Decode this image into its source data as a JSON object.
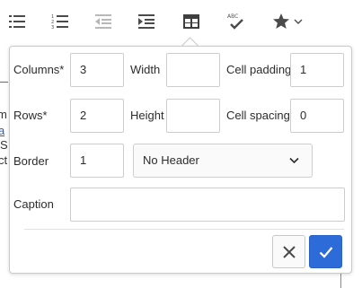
{
  "toolbar": {
    "items": [
      "bulleted-list",
      "numbered-list",
      "outdent",
      "indent",
      "table",
      "spellcheck",
      "more"
    ],
    "spellcheck_text": "ABC"
  },
  "background": {
    "fragments": [
      "m",
      "a",
      "S",
      "ct"
    ]
  },
  "table_dialog": {
    "columns_label": "Columns*",
    "columns_value": "3",
    "width_label": "Width",
    "width_value": "",
    "cell_padding_label": "Cell padding",
    "cell_padding_value": "1",
    "rows_label": "Rows*",
    "rows_value": "2",
    "height_label": "Height",
    "height_value": "",
    "cell_spacing_label": "Cell spacing",
    "cell_spacing_value": "0",
    "border_label": "Border",
    "border_value": "1",
    "header_select_value": "No Header",
    "caption_label": "Caption",
    "caption_value": ""
  },
  "colors": {
    "accent": "#2d6bd9",
    "icon": "#4b4b4b",
    "icon_disabled": "#b8b8b8"
  }
}
